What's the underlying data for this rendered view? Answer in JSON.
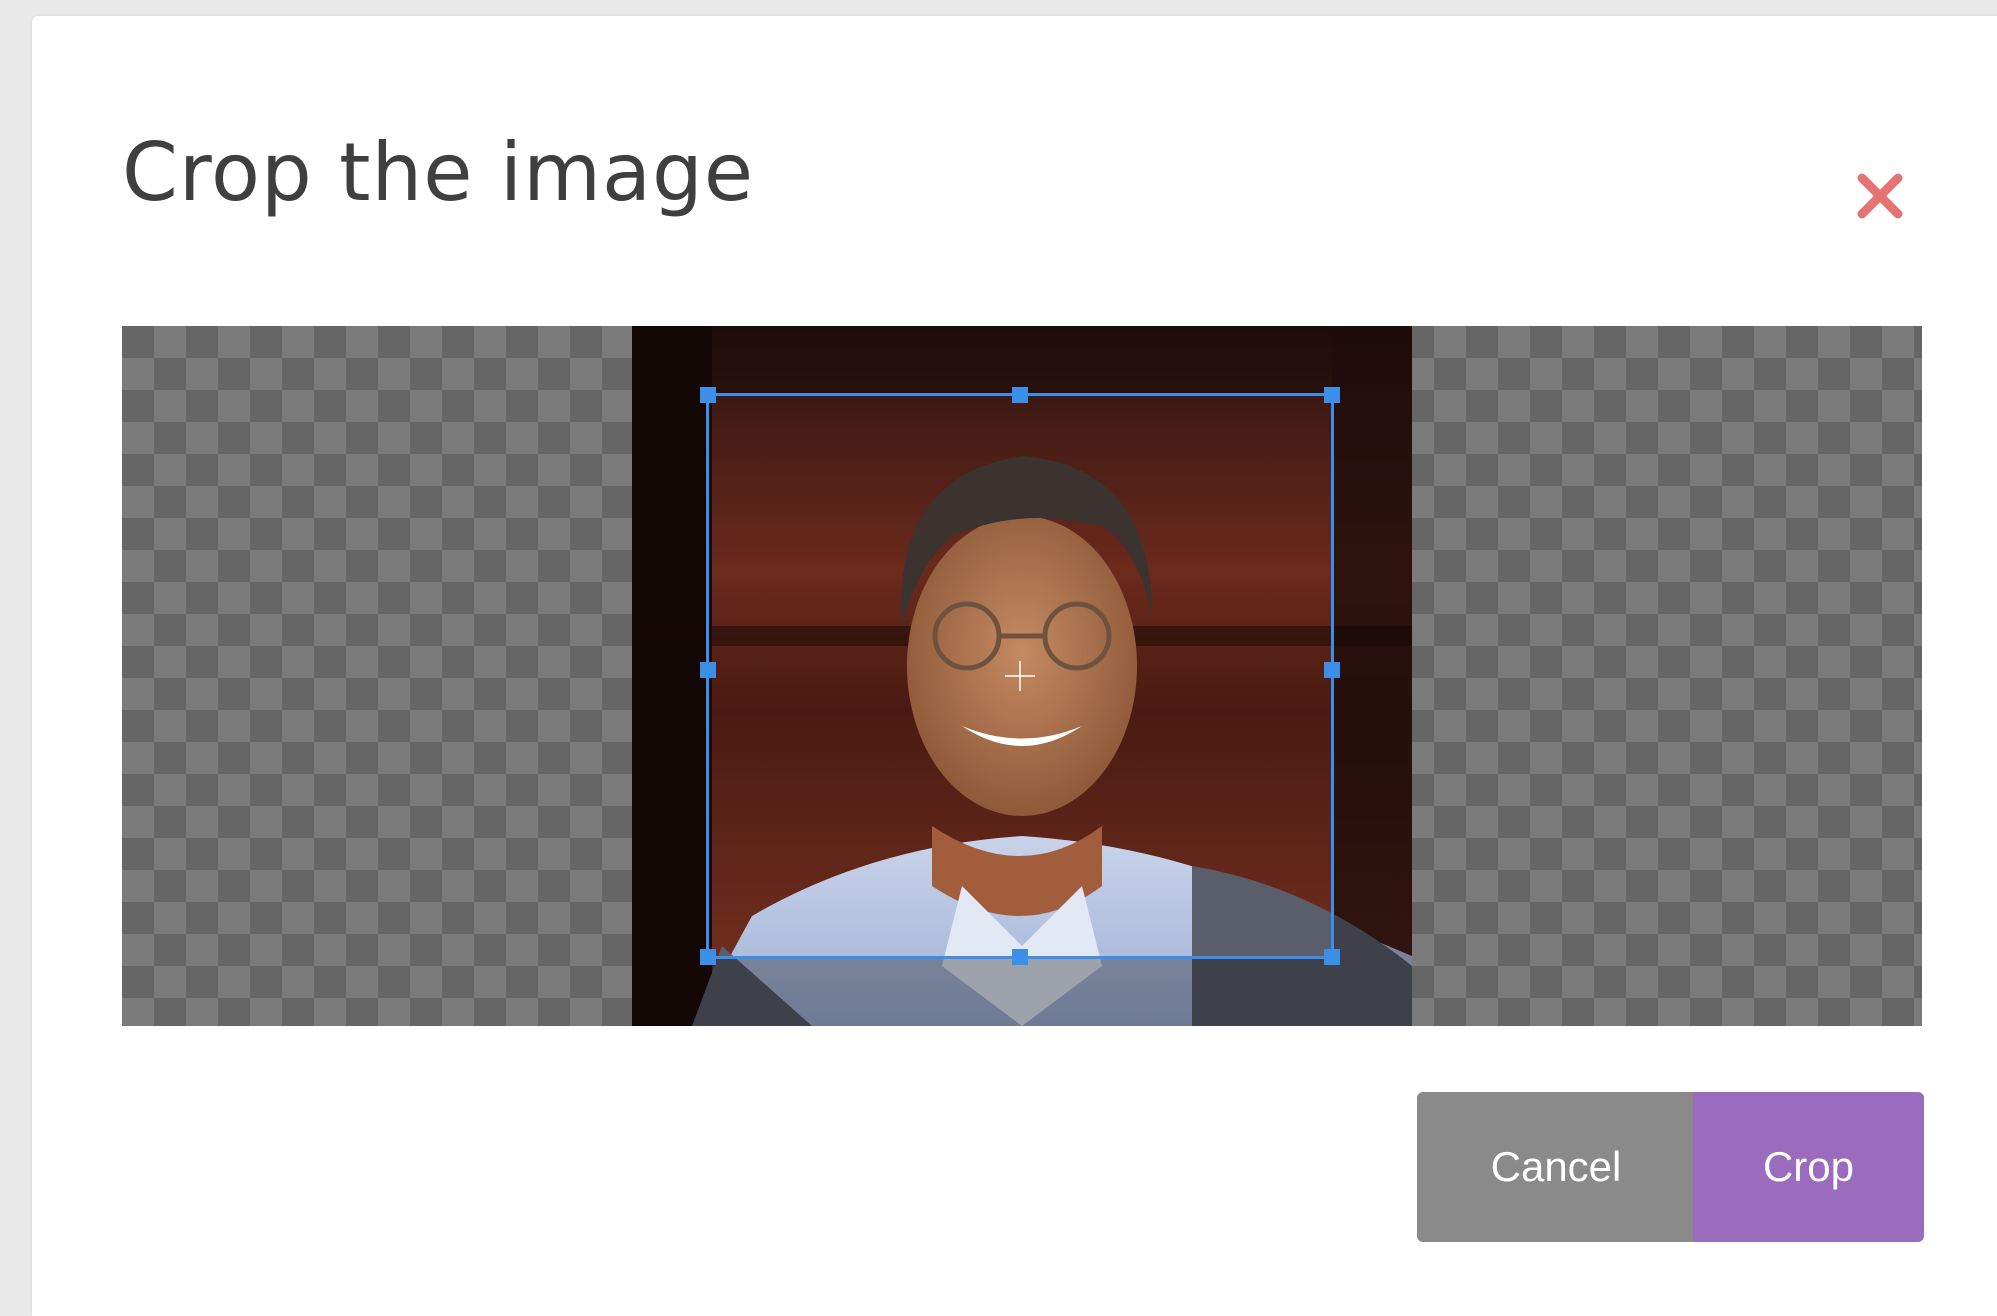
{
  "dialog": {
    "title": "Crop the image",
    "close_icon": "close-icon",
    "close_color": "#e57373"
  },
  "cropper": {
    "background": "checkerboard",
    "selection_color": "#3c8fe8"
  },
  "actions": {
    "cancel_label": "Cancel",
    "crop_label": "Crop",
    "cancel_color": "#8a8a8a",
    "crop_color": "#9b6bbd"
  }
}
